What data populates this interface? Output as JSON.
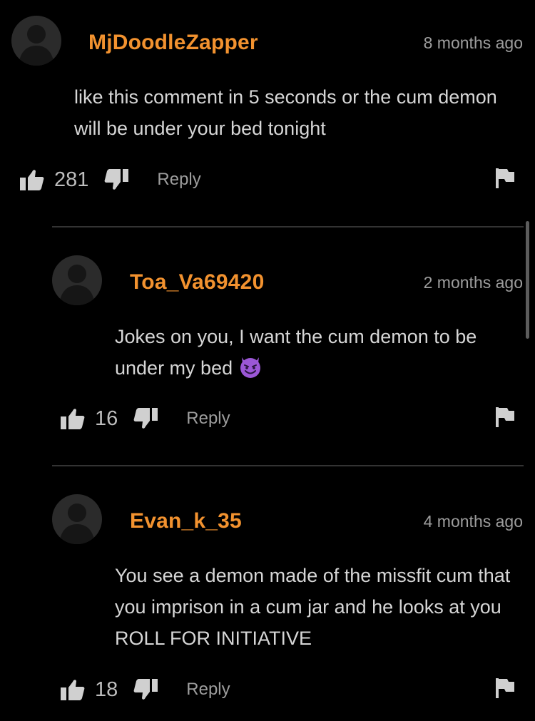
{
  "comments": [
    {
      "username": "MjDoodleZapper",
      "timestamp": "8 months ago",
      "text": "like this comment in 5 seconds or the cum demon will be under your bed tonight",
      "likes": "281",
      "reply_label": "Reply"
    },
    {
      "username": "Toa_Va69420",
      "timestamp": "2 months ago",
      "text": "Jokes on you, I want the cum demon to be under my bed",
      "emoji": "smiling-devil-emoji",
      "likes": "16",
      "reply_label": "Reply"
    },
    {
      "username": "Evan_k_35",
      "timestamp": "4 months ago",
      "text": "You see a demon made of the missfit cum that you imprison in a cum jar and he looks at you ROLL FOR INITIATIVE",
      "likes": "18",
      "reply_label": "Reply"
    }
  ],
  "colors": {
    "background": "#000000",
    "username": "#f2922f",
    "text": "#d6d6d6",
    "muted": "#9d9d9d",
    "divider": "#333333"
  },
  "icons": [
    "avatar-placeholder-icon",
    "thumbs-up-icon",
    "thumbs-down-icon",
    "flag-icon"
  ]
}
